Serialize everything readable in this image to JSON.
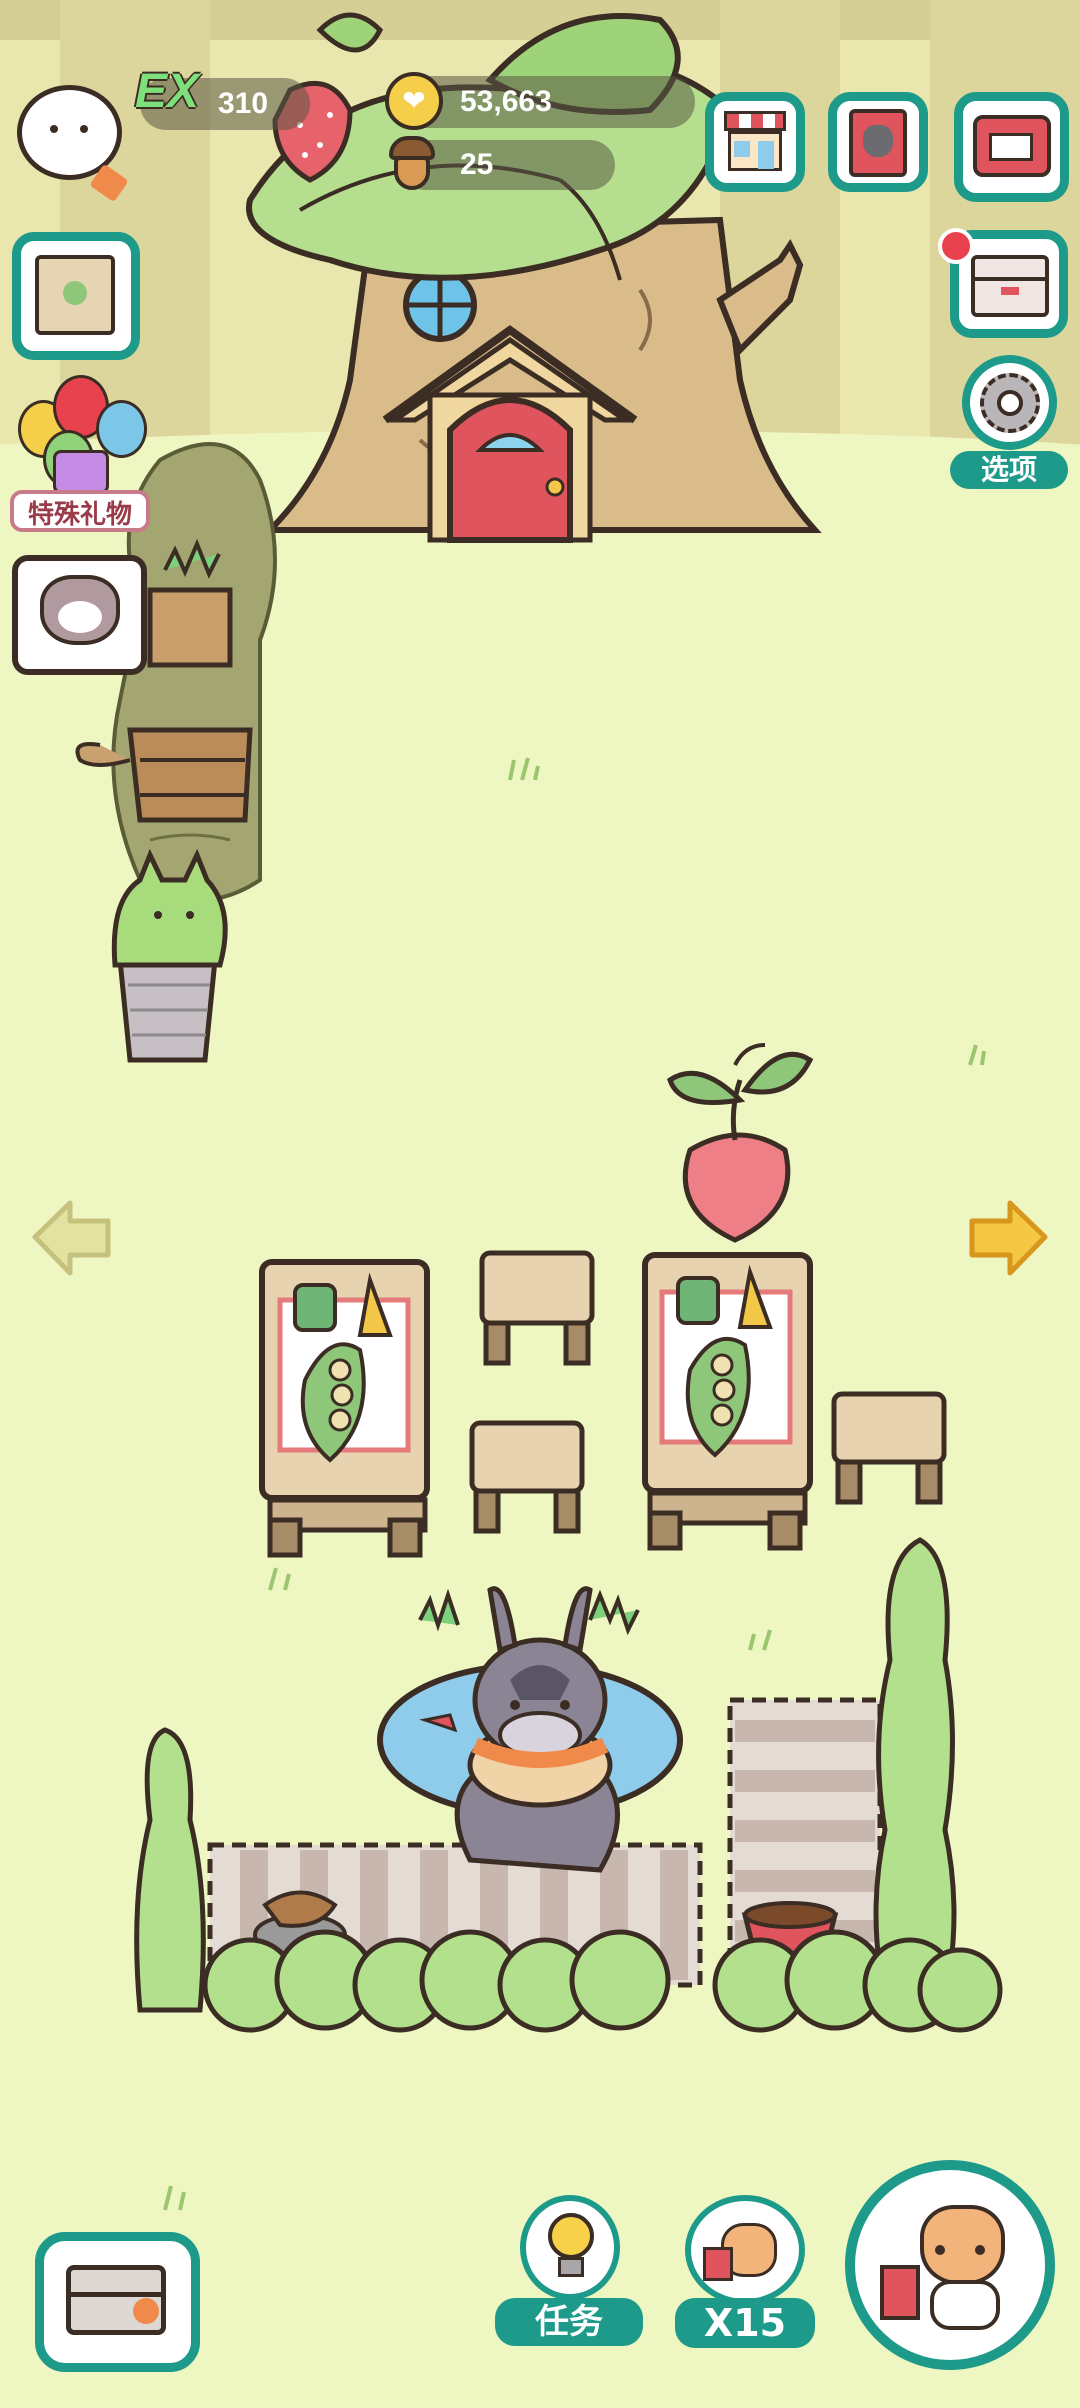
{
  "hud": {
    "ex_badge": "EX",
    "ex_value": "310",
    "coins_value": "53,663",
    "acorns_value": "25",
    "special_gift_label": "特殊礼物",
    "options_label": "选项"
  },
  "bottom_bar": {
    "tasks_label": "任务",
    "cats_multiplier_label": "X15"
  },
  "icons": {
    "coin": "paw-coin-icon",
    "acorn": "acorn-icon",
    "shop": "shop-icon",
    "album": "cat-album-icon",
    "mailbox": "mailbox-icon",
    "storage": "storage-box-icon",
    "options": "gear-icon",
    "map": "treasure-map-icon",
    "gift": "balloon-gift-icon",
    "chat": "cat-chat-icon",
    "nav_left": "arrow-left-icon",
    "nav_right": "arrow-right-icon",
    "tasks": "lightbulb-icon",
    "delivery_box": "delivery-box-icon",
    "summon": "cat-megaphone-icon"
  },
  "colors": {
    "teal": "#1e9a8a",
    "grass": "#eef7c2",
    "tree_bark": "#d9bc8a",
    "door_red": "#e0555d",
    "leaf_green": "#a6d88a"
  }
}
